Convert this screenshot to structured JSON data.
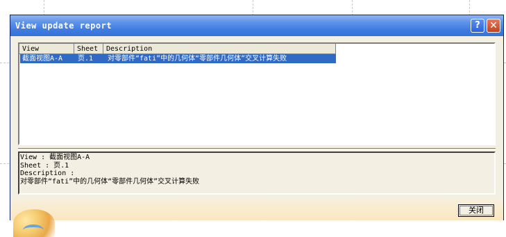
{
  "window": {
    "title": "View update report",
    "help_label": "?",
    "close_label": "✕"
  },
  "list": {
    "columns": [
      "View",
      "Sheet",
      "Description"
    ],
    "rows": [
      {
        "view": "截面视图A-A",
        "sheet": "页.1",
        "description": "对零部件“fati”中的几何体“零部件几何体”交叉计算失败"
      }
    ]
  },
  "detail": {
    "view_line": "View : 截面视图A-A",
    "sheet_line": "Sheet : 页.1",
    "description_label": "Description :",
    "description_text": "对零部件“fati”中的几何体“零部件几何体”交叉计算失败"
  },
  "footer": {
    "close_button_label": "关闭"
  },
  "colors": {
    "titlebar": "#3f7be0",
    "selection": "#316ac5",
    "dialog_bg": "#f3efe2"
  },
  "icons": [
    "help-icon",
    "close-icon",
    "app-logo"
  ]
}
